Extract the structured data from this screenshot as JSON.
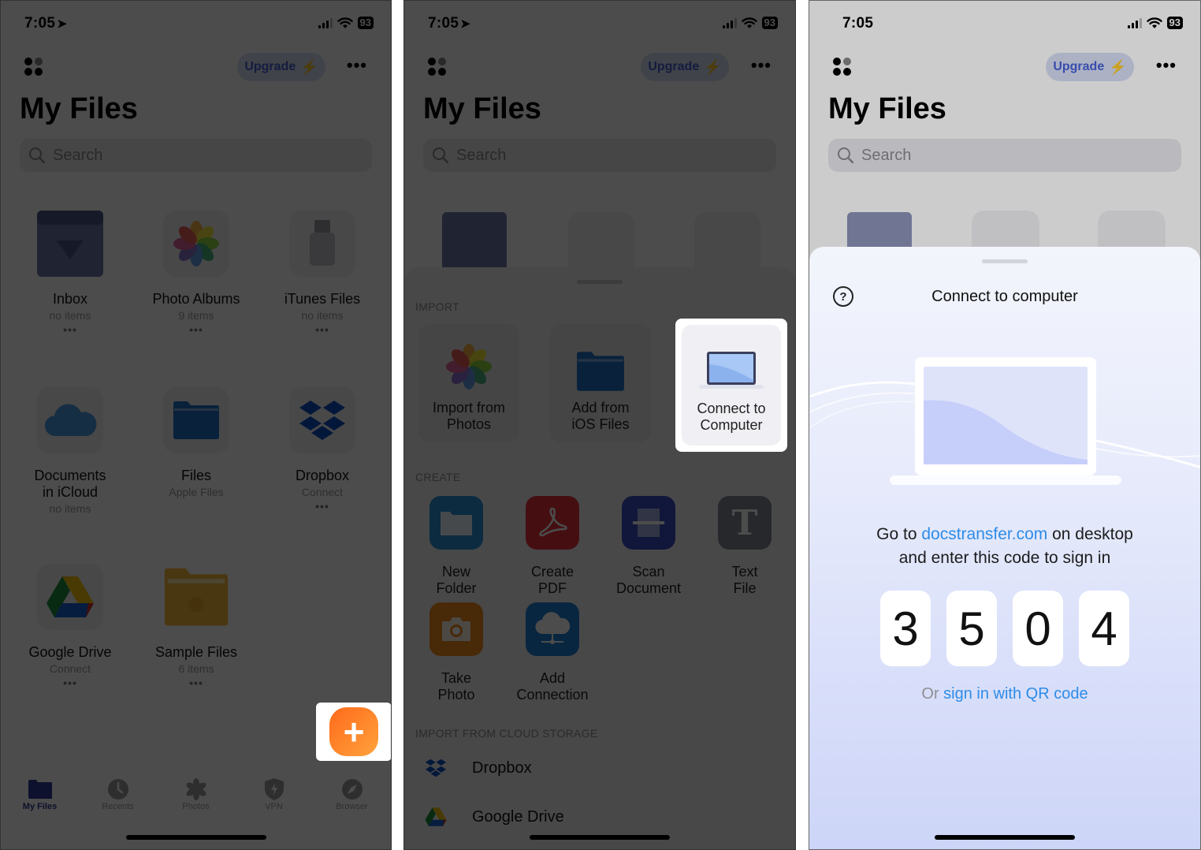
{
  "status_bar": {
    "time": "7:05",
    "battery": "93"
  },
  "header": {
    "upgrade_label": "Upgrade",
    "title": "My Files",
    "search_placeholder": "Search"
  },
  "panel1": {
    "tiles": [
      {
        "name": "Inbox",
        "sub": "no items",
        "icon": "inbox-icon"
      },
      {
        "name": "Photo Albums",
        "sub": "9 items",
        "icon": "photos-icon"
      },
      {
        "name": "iTunes Files",
        "sub": "no items",
        "icon": "usb-icon"
      },
      {
        "name": "Documents in iCloud",
        "name_line1": "Documents",
        "name_line2": "in iCloud",
        "sub": "no items",
        "icon": "icloud-icon"
      },
      {
        "name": "Files",
        "sub": "Apple Files",
        "icon": "folder-icon"
      },
      {
        "name": "Dropbox",
        "sub": "Connect",
        "icon": "dropbox-icon"
      },
      {
        "name": "Google Drive",
        "sub": "Connect",
        "icon": "google-drive-icon"
      },
      {
        "name": "Sample Files",
        "sub": "6 items",
        "icon": "sample-folder-icon"
      }
    ],
    "more_dots": "•••",
    "fab_label": "+",
    "tabs": [
      {
        "label": "My Files",
        "icon": "folder-icon",
        "active": true
      },
      {
        "label": "Recents",
        "icon": "clock-icon",
        "active": false
      },
      {
        "label": "Photos",
        "icon": "photos-icon",
        "active": false
      },
      {
        "label": "VPN",
        "icon": "shield-icon",
        "active": false
      },
      {
        "label": "Browser",
        "icon": "compass-icon",
        "active": false
      }
    ]
  },
  "panel2": {
    "import_header": "IMPORT",
    "import_items": [
      {
        "line1": "Import from",
        "line2": "Photos"
      },
      {
        "line1": "Add from",
        "line2": "iOS Files"
      },
      {
        "line1": "Connect to",
        "line2": "Computer"
      }
    ],
    "create_header": "CREATE",
    "create_items": [
      {
        "line1": "New",
        "line2": "Folder",
        "color": "#2a8fd6"
      },
      {
        "line1": "Create",
        "line2": "PDF",
        "color": "#e8353f"
      },
      {
        "line1": "Scan",
        "line2": "Document",
        "color": "#3a4fc2"
      },
      {
        "line1": "Text",
        "line2": "File",
        "color": "#7f8592"
      },
      {
        "line1": "Take",
        "line2": "Photo",
        "color": "#f08a1c"
      },
      {
        "line1": "Add",
        "line2": "Connection",
        "color": "#1f7fd8"
      }
    ],
    "cloud_header": "IMPORT FROM CLOUD STORAGE",
    "cloud_items": [
      {
        "label": "Dropbox"
      },
      {
        "label": "Google Drive"
      }
    ]
  },
  "panel3": {
    "modal_title": "Connect to computer",
    "help_icon": "?",
    "instr_prefix": "Go to ",
    "instr_link": "docstransfer.com",
    "instr_suffix": " on desktop",
    "instr_line2": "and enter this code to sign in",
    "code_digits": [
      "3",
      "5",
      "0",
      "4"
    ],
    "qr_prefix": "Or ",
    "qr_link": "sign in with QR code"
  }
}
